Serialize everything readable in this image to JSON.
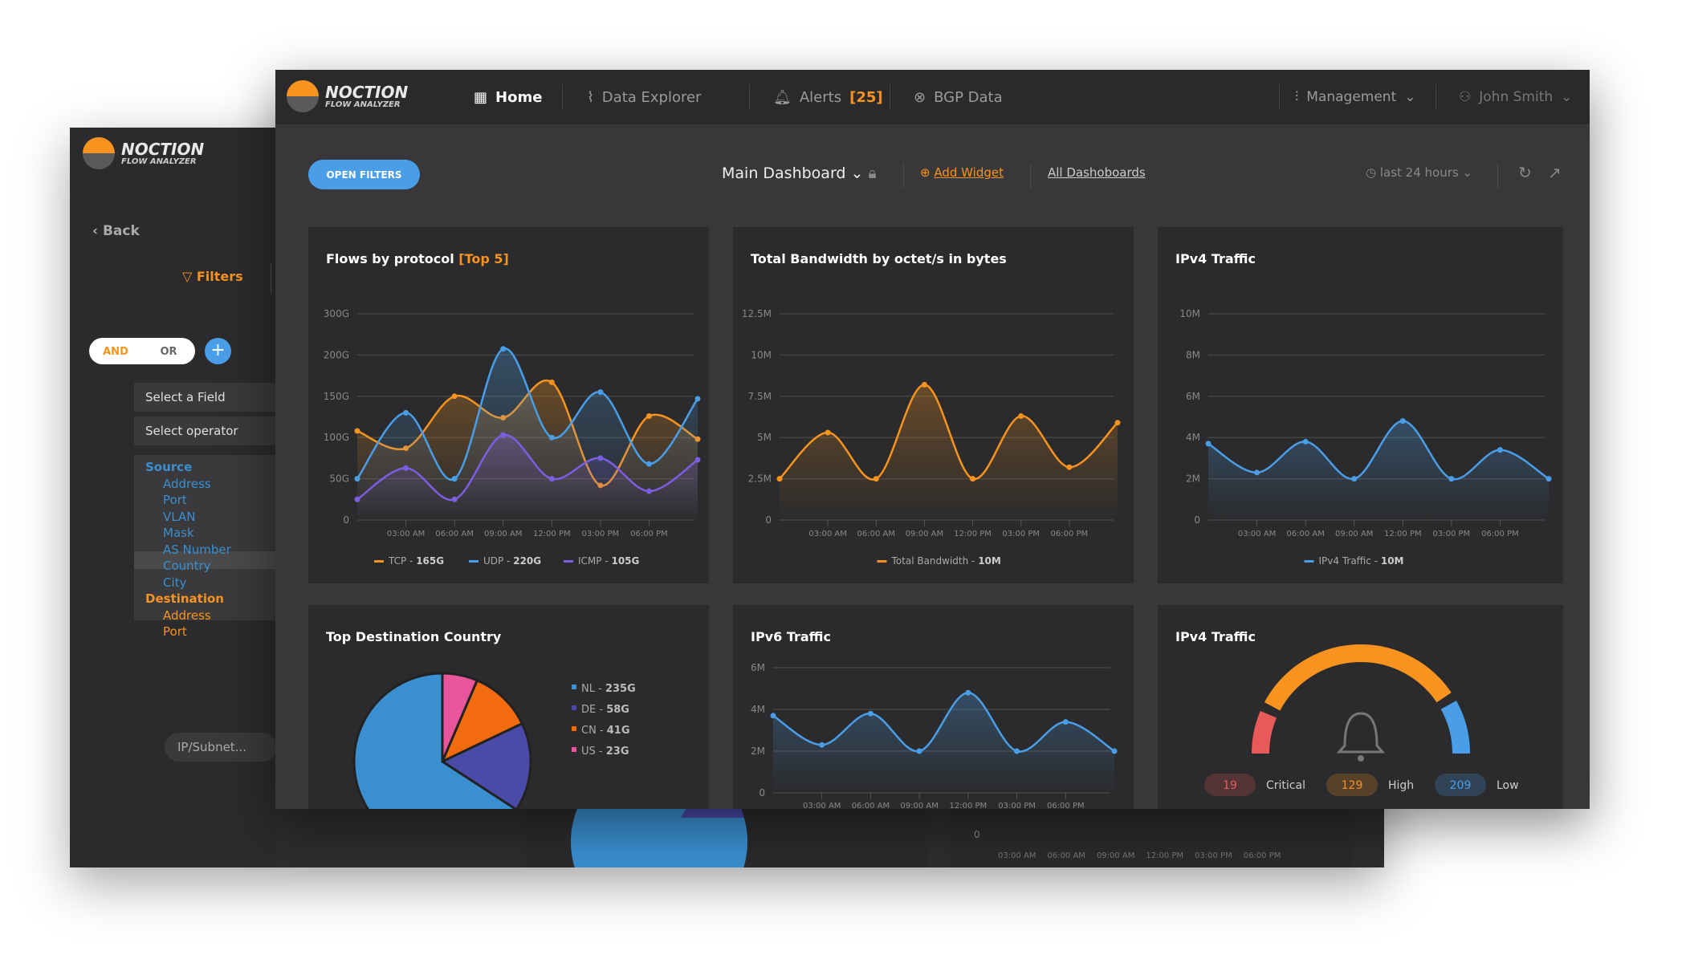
{
  "back_window": {
    "logo": {
      "name": "NOCTION",
      "sub": "FLOW ANALYZER"
    },
    "back_label": "Back",
    "filters_label": "Filters",
    "and_label": "AND",
    "or_label": "OR",
    "add_label": "+",
    "select_field": "Select a Field",
    "select_operator": "Select operator",
    "field_groups": [
      {
        "label": "Source",
        "color": "#3a8fd0",
        "items": [
          "Address",
          "Port",
          "VLAN",
          "Mask",
          "AS Number",
          "Country",
          "City"
        ]
      },
      {
        "label": "Destination",
        "color": "#f7931e",
        "items": [
          "Address",
          "Port"
        ]
      }
    ],
    "highlighted_item": "Mask",
    "ip_placeholder": "IP/Subnet...",
    "bg_chart": {
      "y_zero": "0",
      "x_labels": [
        "03:00 AM",
        "06:00 AM",
        "09:00 AM",
        "12:00 PM",
        "03:00 PM",
        "06:00 PM"
      ]
    }
  },
  "nav": {
    "logo": {
      "name": "NOCTION",
      "sub": "FLOW ANALYZER"
    },
    "home": "Home",
    "data_explorer": "Data Explorer",
    "alerts": "Alerts",
    "alerts_count": "[25]",
    "bgp": "BGP Data",
    "management": "Management",
    "user": "John Smith"
  },
  "toolbar": {
    "open_filters": "OPEN FILTERS",
    "dashboard": "Main Dashboard",
    "add_widget": "Add Widget",
    "all_dashboards": "All Dashoboards",
    "range": "last 24 hours"
  },
  "colors": {
    "orange": "#f7931e",
    "blue": "#4a9ee8",
    "purple": "#7b5fe0",
    "pink": "#e8559b",
    "red": "#e85a5a",
    "navy": "#4a4aa8"
  },
  "chart_data": [
    {
      "id": "flows",
      "type": "line",
      "title": "Flows by protocol",
      "title_suffix": "[Top 5]",
      "x_labels": [
        "03:00 AM",
        "06:00 AM",
        "09:00 AM",
        "12:00 PM",
        "03:00 PM",
        "06:00 PM"
      ],
      "y_ticks": [
        0,
        50,
        100,
        150,
        200,
        300
      ],
      "y_tick_labels": [
        "0",
        "50G",
        "100G",
        "150G",
        "200G",
        "300G"
      ],
      "grid": true,
      "series": [
        {
          "name": "TCP",
          "total": "165G",
          "color": "#f7931e",
          "values": [
            108,
            87,
            150,
            124,
            167,
            42,
            126,
            98
          ]
        },
        {
          "name": "UDP",
          "total": "220G",
          "color": "#4a9ee8",
          "values": [
            50,
            130,
            50,
            215,
            100,
            155,
            68,
            147
          ]
        },
        {
          "name": "ICMP",
          "total": "105G",
          "color": "#7b5fe0",
          "values": [
            25,
            63,
            25,
            103,
            50,
            75,
            35,
            73
          ]
        }
      ]
    },
    {
      "id": "bandwidth",
      "type": "area",
      "title": "Total Bandwidth by octet/s in bytes",
      "x_labels": [
        "03:00 AM",
        "06:00 AM",
        "09:00 AM",
        "12:00 PM",
        "03:00 PM",
        "06:00 PM"
      ],
      "y_ticks": [
        0,
        2.5,
        5,
        7.5,
        10,
        12.5
      ],
      "y_tick_labels": [
        "0",
        "2.5M",
        "5M",
        "7.5M",
        "10M",
        "12.5M"
      ],
      "grid": true,
      "series": [
        {
          "name": "Total Bandwidth",
          "total": "10M",
          "color": "#f7931e",
          "values": [
            2.5,
            5.3,
            2.5,
            8.2,
            2.5,
            6.3,
            3.2,
            5.9
          ]
        }
      ]
    },
    {
      "id": "ipv4",
      "type": "area",
      "title": "IPv4 Traffic",
      "x_labels": [
        "03:00 AM",
        "06:00 AM",
        "09:00 AM",
        "12:00 PM",
        "03:00 PM",
        "06:00 PM"
      ],
      "y_ticks": [
        0,
        2,
        4,
        6,
        8,
        10
      ],
      "y_tick_labels": [
        "0",
        "2M",
        "4M",
        "6M",
        "8M",
        "10M"
      ],
      "grid": true,
      "series": [
        {
          "name": "IPv4 Traffic",
          "total": "10M",
          "color": "#4a9ee8",
          "values": [
            3.7,
            2.3,
            3.8,
            2.0,
            4.8,
            2.0,
            3.4,
            2.0
          ]
        }
      ]
    },
    {
      "id": "country",
      "type": "pie",
      "title": "Top Destination Country",
      "slices": [
        {
          "label": "US",
          "value": 23,
          "unit": "G",
          "color": "#e8559b"
        },
        {
          "label": "CN",
          "value": 41,
          "unit": "G",
          "color": "#f26b0f"
        },
        {
          "label": "DE",
          "value": 58,
          "unit": "G",
          "color": "#4a4aa8"
        },
        {
          "label": "NL",
          "value": 235,
          "unit": "G",
          "color": "#3a8fd0"
        }
      ],
      "legend_order": [
        "NL",
        "DE",
        "CN",
        "US"
      ]
    },
    {
      "id": "ipv6",
      "type": "area",
      "title": "IPv6 Traffic",
      "x_labels": [
        "03:00 AM",
        "06:00 AM",
        "09:00 AM",
        "12:00 PM",
        "03:00 PM",
        "06:00 PM"
      ],
      "y_ticks": [
        0,
        2,
        4,
        6
      ],
      "y_tick_labels": [
        "0",
        "2M",
        "4M",
        "6M"
      ],
      "grid": true,
      "series": [
        {
          "name": "IPv6 Traffic",
          "color": "#4a9ee8",
          "values": [
            3.7,
            2.3,
            3.8,
            2.0,
            4.8,
            2.0,
            3.4,
            2.0
          ]
        }
      ]
    },
    {
      "id": "alerts",
      "type": "gauge",
      "title": "IPv4 Traffic",
      "segments": [
        {
          "label": "Critical",
          "value": 19,
          "color": "#e85a5a"
        },
        {
          "label": "High",
          "value": 129,
          "color": "#f7931e"
        },
        {
          "label": "Low",
          "value": 209,
          "color": "#4a9ee8"
        }
      ]
    }
  ]
}
